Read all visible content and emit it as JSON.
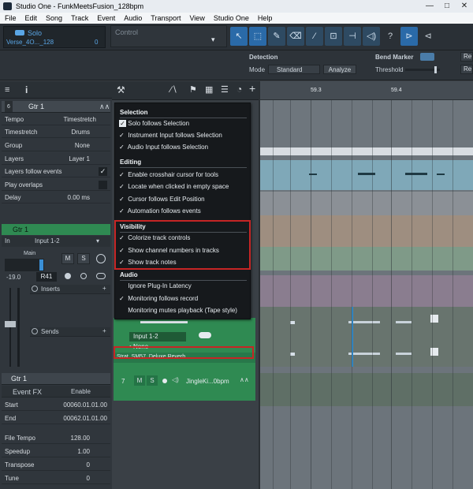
{
  "window": {
    "title": "Studio One - FunkMeetsFusion_128bpm",
    "min": "—",
    "max": "□",
    "close": "✕"
  },
  "menu": [
    "File",
    "Edit",
    "Song",
    "Track",
    "Event",
    "Audio",
    "Transport",
    "View",
    "Studio One",
    "Help"
  ],
  "toolbar": {
    "solo_label": "Solo",
    "song_label": "Verse_4O..._128",
    "song_value": "0",
    "control_label": "Control",
    "arrow_glyph": "▾"
  },
  "tools": [
    "↖",
    "⬚",
    "✎",
    "⌫",
    "⁄",
    "⊡",
    "⊣",
    "◁)",
    "?",
    "⊳",
    "⊲"
  ],
  "detection": {
    "title": "Detection",
    "mode_label": "Mode",
    "mode_value": "Standard",
    "analyze": "Analyze",
    "bend_title": "Bend Marker",
    "threshold_label": "Threshold",
    "re": "Re"
  },
  "inspector": {
    "track_name": "Gtr 1",
    "num": "6",
    "tempo_label": "Tempo",
    "tempo_value": "Timestretch",
    "timestretch_label": "Timestretch",
    "timestretch_value": "Drums",
    "group_label": "Group",
    "group_value": "None",
    "layers_label": "Layers",
    "layers_value": "Layer 1",
    "layers_follow_label": "Layers follow events",
    "play_overlaps_label": "Play overlaps",
    "delay_label": "Delay",
    "delay_value": "0.00 ms",
    "channel_name": "Gtr 1",
    "in_label": "In",
    "in_value": "Input 1-2",
    "main_label": "Main",
    "m": "M",
    "s": "S",
    "vol": "-19.0",
    "pan": "R41",
    "inserts": "Inserts",
    "sends": "Sends",
    "event_name": "Gtr 1",
    "event_fx": "Event FX",
    "enable": "Enable",
    "start_label": "Start",
    "start_value": "00060.01.01.00",
    "end_label": "End",
    "end_value": "00062.01.01.00",
    "file_tempo_label": "File Tempo",
    "file_tempo_value": "128.00",
    "speedup_label": "Speedup",
    "speedup_value": "1.00",
    "transpose_label": "Transpose",
    "transpose_value": "0",
    "tune_label": "Tune",
    "tune_value": "0"
  },
  "tracks": {
    "input": "Input 1-2",
    "none": "None",
    "notes": "Strat, SM57, Deluxe Reverb",
    "t7_num": "7",
    "t7_m": "M",
    "t7_s": "S",
    "t7_name": "JingleKi...0bpm"
  },
  "ruler": {
    "m1": "59.3",
    "m2": "59.4"
  },
  "popup": {
    "selection": "Selection",
    "s1": "Solo follows Selection",
    "s2": "Instrument Input follows Selection",
    "s3": "Audio Input follows Selection",
    "editing": "Editing",
    "e1": "Enable crosshair cursor for tools",
    "e2": "Locate when clicked in empty space",
    "e3": "Cursor follows Edit Position",
    "e4": "Automation follows events",
    "visibility": "Visibility",
    "v1": "Colorize track controls",
    "v2": "Show channel numbers in tracks",
    "v3": "Show track notes",
    "audio": "Audio",
    "a1": "Ignore Plug-In Latency",
    "a2": "Monitoring follows record",
    "a3": "Monitoring mutes playback (Tape style)",
    "check": "✓"
  }
}
